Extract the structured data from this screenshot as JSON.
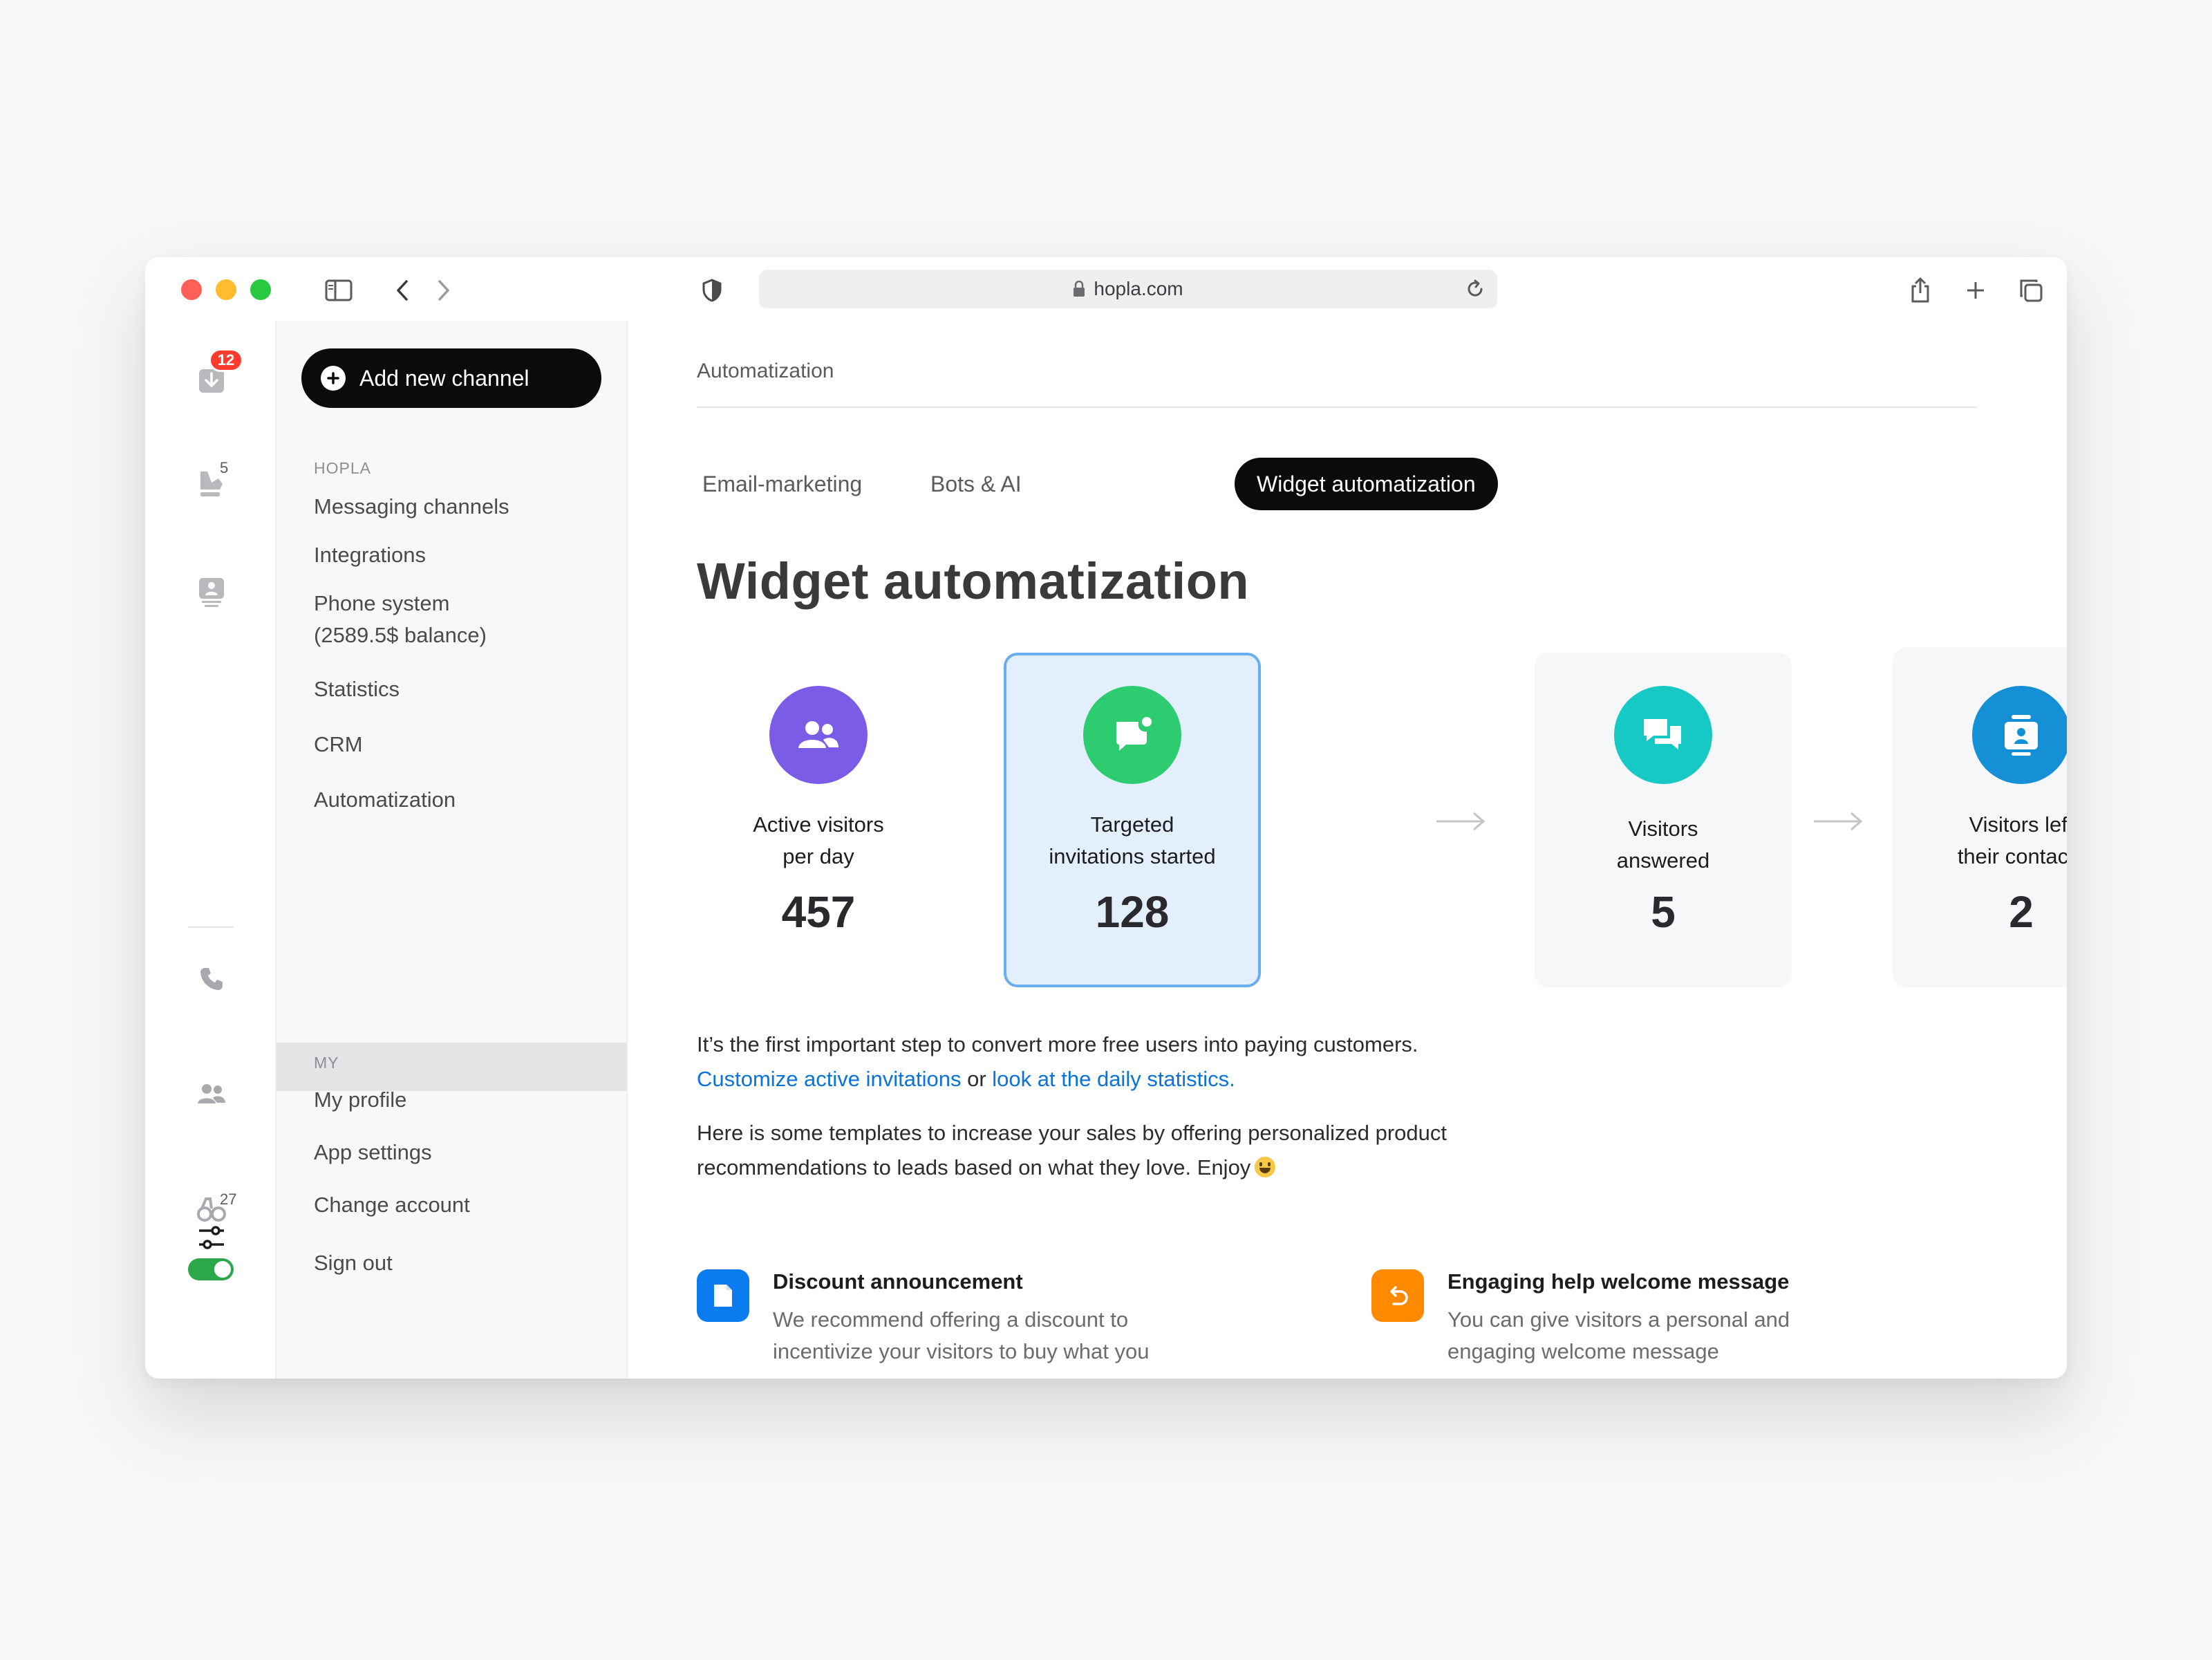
{
  "browser": {
    "url": "hopla.com"
  },
  "rail": {
    "inbox_badge": "12",
    "broadcast_count": "5",
    "visitors_count": "27"
  },
  "nav": {
    "add_button": "Add new channel",
    "section_hopla": "HOPLA",
    "items": [
      {
        "label": "Messaging channels"
      },
      {
        "label": "Integrations"
      },
      {
        "label": "Phone system\n(2589.5$ balance)"
      },
      {
        "label": "Statistics"
      },
      {
        "label": "CRM"
      },
      {
        "label": "Automatization"
      }
    ],
    "section_my": "MY",
    "my_items": [
      {
        "label": "My profile"
      },
      {
        "label": "App settings"
      },
      {
        "label": "Change account"
      },
      {
        "label": "Sign out"
      }
    ]
  },
  "main": {
    "breadcrumb": "Automatization",
    "tabs": [
      {
        "label": "Email-marketing"
      },
      {
        "label": "Bots & AI"
      },
      {
        "label": "Widget automatization"
      }
    ],
    "title": "Widget automatization",
    "stats": [
      {
        "label": "Active visitors\nper day",
        "value": "457",
        "icon": "users-icon",
        "color": "#7b5ce6"
      },
      {
        "label": "Targeted\ninvitations started",
        "value": "128",
        "icon": "chat-notification-icon",
        "color": "#2ecc71"
      },
      {
        "label": "Visitors\nanswered",
        "value": "5",
        "icon": "conversation-icon",
        "color": "#17c9c4"
      },
      {
        "label": "Visitors left\ntheir contacts",
        "value": "2",
        "icon": "contact-card-icon",
        "color": "#1590d6"
      }
    ],
    "intro_text": "It’s the first important step to convert more free users into paying customers.",
    "link_customize": "Customize active invitations",
    "link_or": " or ",
    "link_stats": "look at the daily statistics.",
    "templates_text": "Here is some templates to increase your sales by offering personalized product recommendations to leads based on what they love. Enjoy",
    "templates": [
      {
        "title": "Discount announcement",
        "desc": "We recommend offering a discount to incentivize your visitors to buy what you",
        "icon": "document-icon",
        "color": "#0a7cf0"
      },
      {
        "title": "Engaging help welcome message",
        "desc": "You can give visitors a personal and engaging welcome message",
        "icon": "undo-arrow-icon",
        "color": "#ff8a00"
      }
    ]
  }
}
